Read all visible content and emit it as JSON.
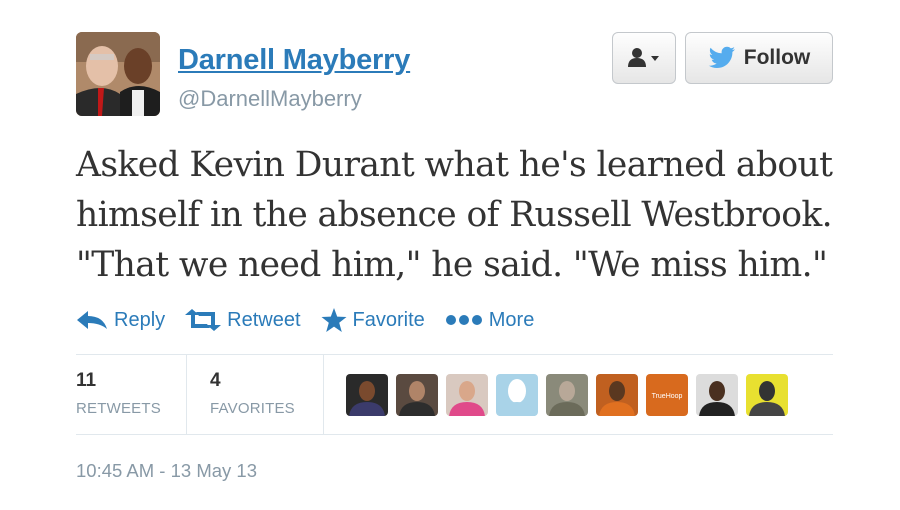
{
  "user": {
    "display_name": "Darnell Mayberry",
    "handle": "@DarnellMayberry",
    "avatar_icon": "profile-photo"
  },
  "buttons": {
    "user_dropdown_icon": "user-dropdown-icon",
    "follow_label": "Follow"
  },
  "tweet": {
    "lines": [
      "Asked Kevin Durant what he's learned about",
      "himself in the absence of Russell Westbrook.",
      "\"That we need him,\" he said. \"We miss him.\""
    ]
  },
  "actions": {
    "reply": "Reply",
    "retweet": "Retweet",
    "favorite": "Favorite",
    "more": "More"
  },
  "stats": {
    "retweets_count": "11",
    "retweets_label": "RETWEETS",
    "favorites_count": "4",
    "favorites_label": "FAVORITES"
  },
  "faces": [
    {
      "name": "face-1",
      "bg": "#2a2a2a",
      "skin": "#7a4a2e",
      "shirt": "#3b3b6b"
    },
    {
      "name": "face-2",
      "bg": "#5a4a40",
      "skin": "#b08468",
      "shirt": "#2d2d2d"
    },
    {
      "name": "face-3",
      "bg": "#d9c9c0",
      "skin": "#d9a78a",
      "shirt": "#e04a8a"
    },
    {
      "name": "face-4",
      "bg": "#a9d3e8",
      "skin": "#ffffff",
      "shirt": "#a9d3e8"
    },
    {
      "name": "face-5",
      "bg": "#8a8a7a",
      "skin": "#b8a898",
      "shirt": "#6b6b5a"
    },
    {
      "name": "face-6",
      "bg": "#c06020",
      "skin": "#5a3820",
      "shirt": "#e07020"
    },
    {
      "name": "face-7",
      "bg": "#d86a1e",
      "skin": "#d86a1e",
      "shirt": "#d86a1e",
      "text": "TrueHoop"
    },
    {
      "name": "face-8",
      "bg": "#dcdcdc",
      "skin": "#4a3020",
      "shirt": "#222222"
    },
    {
      "name": "face-9",
      "bg": "#e8e030",
      "skin": "#333333",
      "shirt": "#444444"
    }
  ],
  "timestamp": "10:45 AM - 13 May 13",
  "colors": {
    "link_blue": "#2b7bb9",
    "muted_gray": "#8899a6",
    "twitter_blue": "#55acee"
  }
}
